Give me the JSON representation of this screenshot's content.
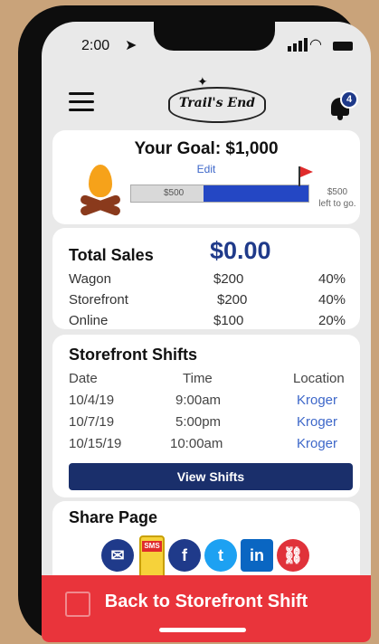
{
  "status": {
    "time": "2:00"
  },
  "header": {
    "logo_text": "Trail's End",
    "notification_count": "4"
  },
  "goal": {
    "title": "Your Goal: $1,000",
    "edit_label": "Edit",
    "progress_label": "$500",
    "progress_fraction": 0.5,
    "left_to_go_amount": "$500",
    "left_to_go_label": "left to go."
  },
  "sales": {
    "title": "Total Sales",
    "total": "$0.00",
    "rows": [
      {
        "channel": "Wagon",
        "amount": "$200",
        "percent": "40%"
      },
      {
        "channel": "Storefront",
        "amount": "$200",
        "percent": "40%"
      },
      {
        "channel": "Online",
        "amount": "$100",
        "percent": "20%"
      }
    ]
  },
  "shifts": {
    "title": "Storefront Shifts",
    "columns": [
      "Date",
      "Time",
      "Location"
    ],
    "rows": [
      {
        "date": "10/4/19",
        "time": "9:00am",
        "location": "Kroger"
      },
      {
        "date": "10/7/19",
        "time": "5:00pm",
        "location": "Kroger"
      },
      {
        "date": "10/15/19",
        "time": "10:00am",
        "location": "Kroger"
      }
    ],
    "button_label": "View Shifts"
  },
  "share": {
    "title": "Share Page",
    "icons": [
      "email-icon",
      "sms-icon",
      "facebook-icon",
      "twitter-icon",
      "linkedin-icon",
      "link-icon"
    ],
    "sms_label": "SMS",
    "facebook_glyph": "f",
    "twitter_glyph": "t",
    "linkedin_glyph": "in"
  },
  "footer": {
    "cta_label": "Back to Storefront Shift"
  },
  "colors": {
    "accent": "#1f3a8a",
    "cta": "#e9343b",
    "link": "#3d67c9",
    "progress": "#2447c4"
  }
}
